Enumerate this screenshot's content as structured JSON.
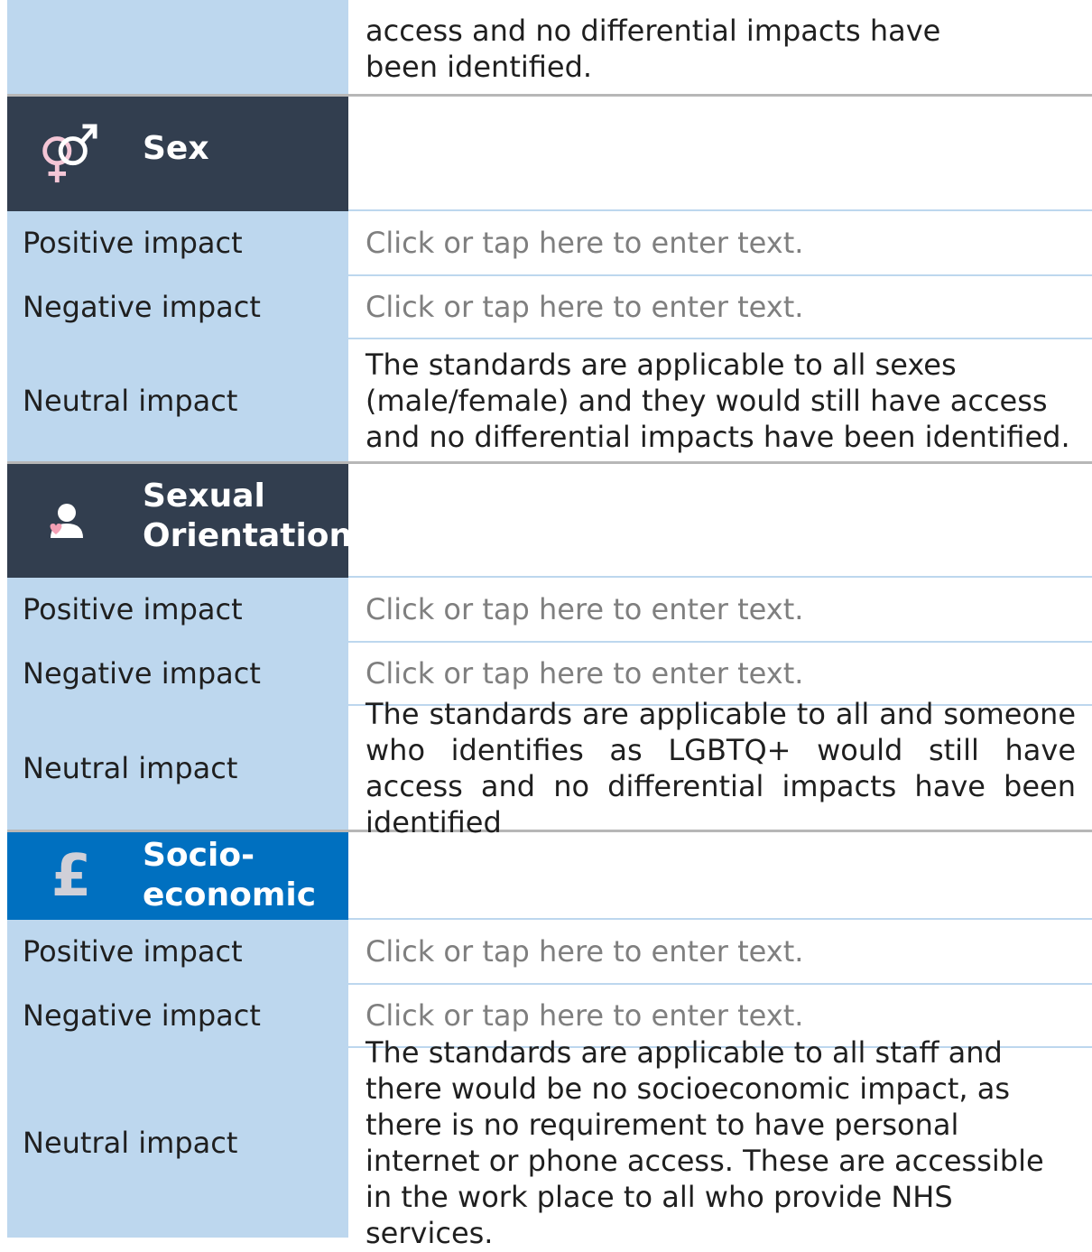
{
  "top_row": {
    "value": "access and no differential impacts have been identified."
  },
  "sections": [
    {
      "title": "Sex",
      "icon": "gender-symbol-icon",
      "rows": [
        {
          "label": "Positive impact",
          "value": "Click or tap here to enter text."
        },
        {
          "label": "Negative impact",
          "value": "Click or tap here to enter text."
        },
        {
          "label": "Neutral impact",
          "value": "The standards are applicable to all sexes (male/female) and they would still have access and no differential impacts have been identified."
        }
      ]
    },
    {
      "title": "Sexual Orientation",
      "icon": "person-heart-icon",
      "rows": [
        {
          "label": "Positive impact",
          "value": "Click or tap here to enter text."
        },
        {
          "label": "Negative impact",
          "value": "Click or tap here to enter text."
        },
        {
          "label": "Neutral impact",
          "value": "The standards are applicable to all and someone who identifies as LGBTQ+ would still have access and no differential impacts have been identified"
        }
      ]
    },
    {
      "title": "Socio-economic",
      "icon": "pound-sign-icon",
      "rows": [
        {
          "label": "Positive impact",
          "value": "Click or tap here to enter text."
        },
        {
          "label": "Negative impact",
          "value": "Click or tap here to enter text."
        },
        {
          "label": "Neutral impact",
          "value": "The standards are applicable to all staff and there would be no socioeconomic impact, as there is no requirement to have personal internet or phone access. These are accessible in the work place to all who provide NHS services."
        }
      ]
    }
  ],
  "colors": {
    "label_bg": "#bdd7ee",
    "header_dark": "#323e4f",
    "header_blue": "#0070c0",
    "placeholder_text": "#7f7f7f"
  }
}
